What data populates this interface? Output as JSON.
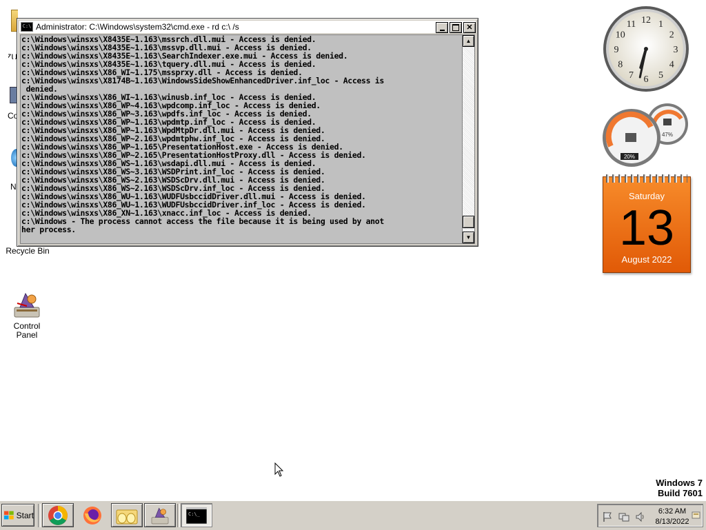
{
  "desktop": {
    "icons": [
      {
        "label": "Recycle Bin"
      },
      {
        "label": "Control Panel",
        "lines": [
          "Control",
          "Panel"
        ]
      }
    ],
    "partial_labels": {
      "zu": "ZU",
      "co": "Co",
      "n": "N"
    },
    "watermark": {
      "line1": "Windows 7",
      "line2": "Build 7601"
    }
  },
  "cmd_window": {
    "title": "Administrator: C:\\Windows\\system32\\cmd.exe - rd  c:\\ /s",
    "icon_text": "C:\\",
    "lines": [
      "c:\\Windows\\winsxs\\X8435E~1.163\\mssrch.dll.mui - Access is denied.",
      "c:\\Windows\\winsxs\\X8435E~1.163\\mssvp.dll.mui - Access is denied.",
      "c:\\Windows\\winsxs\\X8435E~1.163\\SearchIndexer.exe.mui - Access is denied.",
      "c:\\Windows\\winsxs\\X8435E~1.163\\tquery.dll.mui - Access is denied.",
      "c:\\Windows\\winsxs\\X86_WI~1.175\\mssprxy.dll - Access is denied.",
      "c:\\Windows\\winsxs\\X8174B~1.163\\WindowsSideShowEnhancedDriver.inf_loc - Access is",
      " denied.",
      "c:\\Windows\\winsxs\\X86_WI~1.163\\winusb.inf_loc - Access is denied.",
      "c:\\Windows\\winsxs\\X86_WP~4.163\\wpdcomp.inf_loc - Access is denied.",
      "c:\\Windows\\winsxs\\X86_WP~3.163\\wpdfs.inf_loc - Access is denied.",
      "c:\\Windows\\winsxs\\X86_WP~1.163\\wpdmtp.inf_loc - Access is denied.",
      "c:\\Windows\\winsxs\\X86_WP~1.163\\WpdMtpDr.dll.mui - Access is denied.",
      "c:\\Windows\\winsxs\\X86_WP~2.163\\wpdmtphw.inf_loc - Access is denied.",
      "c:\\Windows\\winsxs\\X86_WP~1.165\\PresentationHost.exe - Access is denied.",
      "c:\\Windows\\winsxs\\X86_WP~2.165\\PresentationHostProxy.dll - Access is denied.",
      "c:\\Windows\\winsxs\\X86_WS~1.163\\wsdapi.dll.mui - Access is denied.",
      "c:\\Windows\\winsxs\\X86_WS~3.163\\WSDPrint.inf_loc - Access is denied.",
      "c:\\Windows\\winsxs\\X86_WS~2.163\\WSDScDrv.dll.mui - Access is denied.",
      "c:\\Windows\\winsxs\\X86_WS~2.163\\WSDScDrv.inf_loc - Access is denied.",
      "c:\\Windows\\winsxs\\X86_WU~1.163\\WUDFUsbccidDriver.dll.mui - Access is denied.",
      "c:\\Windows\\winsxs\\X86_WU~1.163\\WUDFUsbccidDriver.inf_loc - Access is denied.",
      "c:\\Windows\\winsxs\\X86_XN~1.163\\xnacc.inf_loc - Access is denied.",
      "c:\\Windows - The process cannot access the file because it is being used by anot",
      "her process."
    ]
  },
  "gadgets": {
    "clock": {
      "numerals": [
        "12",
        "1",
        "2",
        "3",
        "4",
        "5",
        "6",
        "7",
        "8",
        "9",
        "10",
        "11"
      ],
      "hour": 6,
      "minute": 32
    },
    "meter": {
      "cpu_label": "20%",
      "ram_label": "47%"
    },
    "calendar": {
      "weekday": "Saturday",
      "day": "13",
      "month_year": "August 2022"
    }
  },
  "taskbar": {
    "start_label": "Start",
    "apps": [
      "chrome",
      "firefox",
      "explorer",
      "control-panel",
      "cmd"
    ],
    "tray": {
      "time": "6:32 AM",
      "date": "8/13/2022"
    }
  },
  "colors": {
    "console_bg": "#c0c0c0",
    "calendar": "#f0721a",
    "chrome_face": "#d4d0c8"
  }
}
